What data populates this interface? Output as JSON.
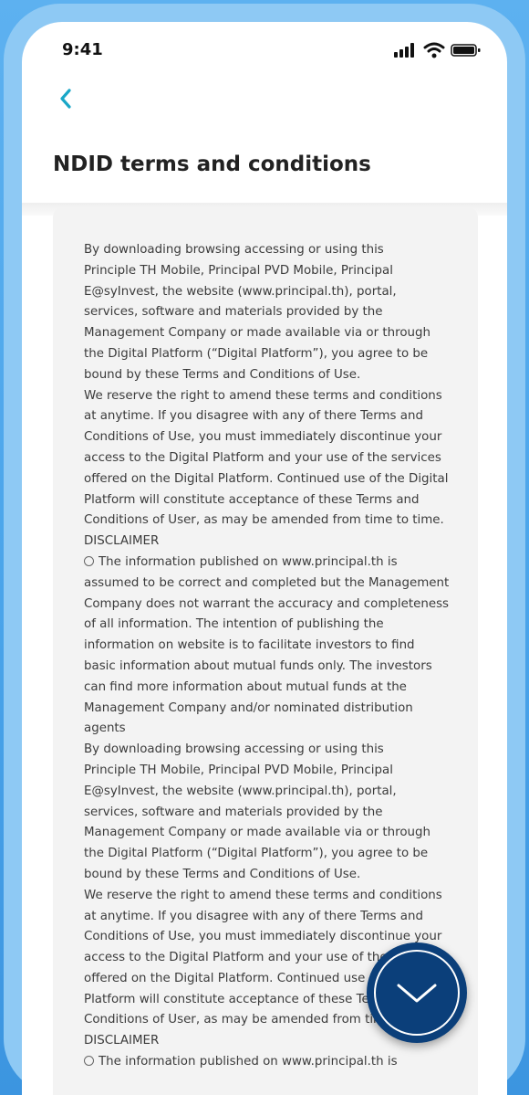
{
  "status_bar": {
    "time": "9:41",
    "icons": [
      "signal-icon",
      "wifi-icon",
      "battery-icon"
    ]
  },
  "header": {
    "back_icon": "chevron-left-icon",
    "title": "NDID terms and conditions"
  },
  "colors": {
    "accent": "#1aa7c7",
    "title": "#222222",
    "body_text": "#3b3b3b",
    "card": "#f3f3f3",
    "button": "#0b3f7a",
    "background": "#4aa4ea"
  },
  "terms": {
    "lines": [
      "By downloading browsing accessing or using this",
      "Principle TH Mobile, Principal PVD Mobile, Principal",
      "E@syInvest, the website (www.principal.th), portal,",
      "services, software and materials provided by the",
      "Management Company or made available via or through",
      "the Digital Platform (“Digital Platform”), you agree to be",
      "bound by these Terms and Conditions of Use.",
      "We reserve the right to amend these terms and conditions",
      "at anytime. If you disagree with any of there Terms and",
      "Conditions of Use, you must immediately discontinue your",
      "access to the Digital Platform and your use of the services",
      "offered on the Digital Platform. Continued use of the Digital",
      "Platform will constitute acceptance of these Terms and",
      "Conditions of User, as may be amended from time to time.",
      "DISCLAIMER",
      "The information published on www.principal.th is",
      "assumed to be correct and completed but the Management",
      "Company does not warrant the accuracy and completeness",
      "of all information. The intention of publishing the",
      "information on website is to facilitate investors to find",
      "basic information about mutual funds only. The investors",
      "can find more information about mutual funds at the",
      "Management Company and/or nominated distribution",
      "agents",
      "By downloading browsing accessing or using this",
      "Principle TH Mobile, Principal PVD Mobile, Principal",
      "E@syInvest, the website (www.principal.th), portal,",
      "services, software and materials provided by the",
      "Management Company or made available via or through",
      "the Digital Platform (“Digital Platform”), you agree to be",
      "bound by these Terms and Conditions of Use.",
      "We reserve the right to amend these terms and conditions",
      "at anytime. If you disagree with any of there Terms and",
      "Conditions of Use, you must immediately discontinue your",
      "access to the Digital Platform and your use of the services",
      "offered on the Digital Platform. Continued use of the Digital",
      "Platform will constitute acceptance of these Terms and",
      "Conditions of User, as may be amended from time to time.",
      "DISCLAIMER",
      "The information published on www.principal.th is"
    ],
    "radio_line_indices": [
      15,
      39
    ]
  },
  "scroll_button": {
    "icon": "chevron-down-icon"
  }
}
